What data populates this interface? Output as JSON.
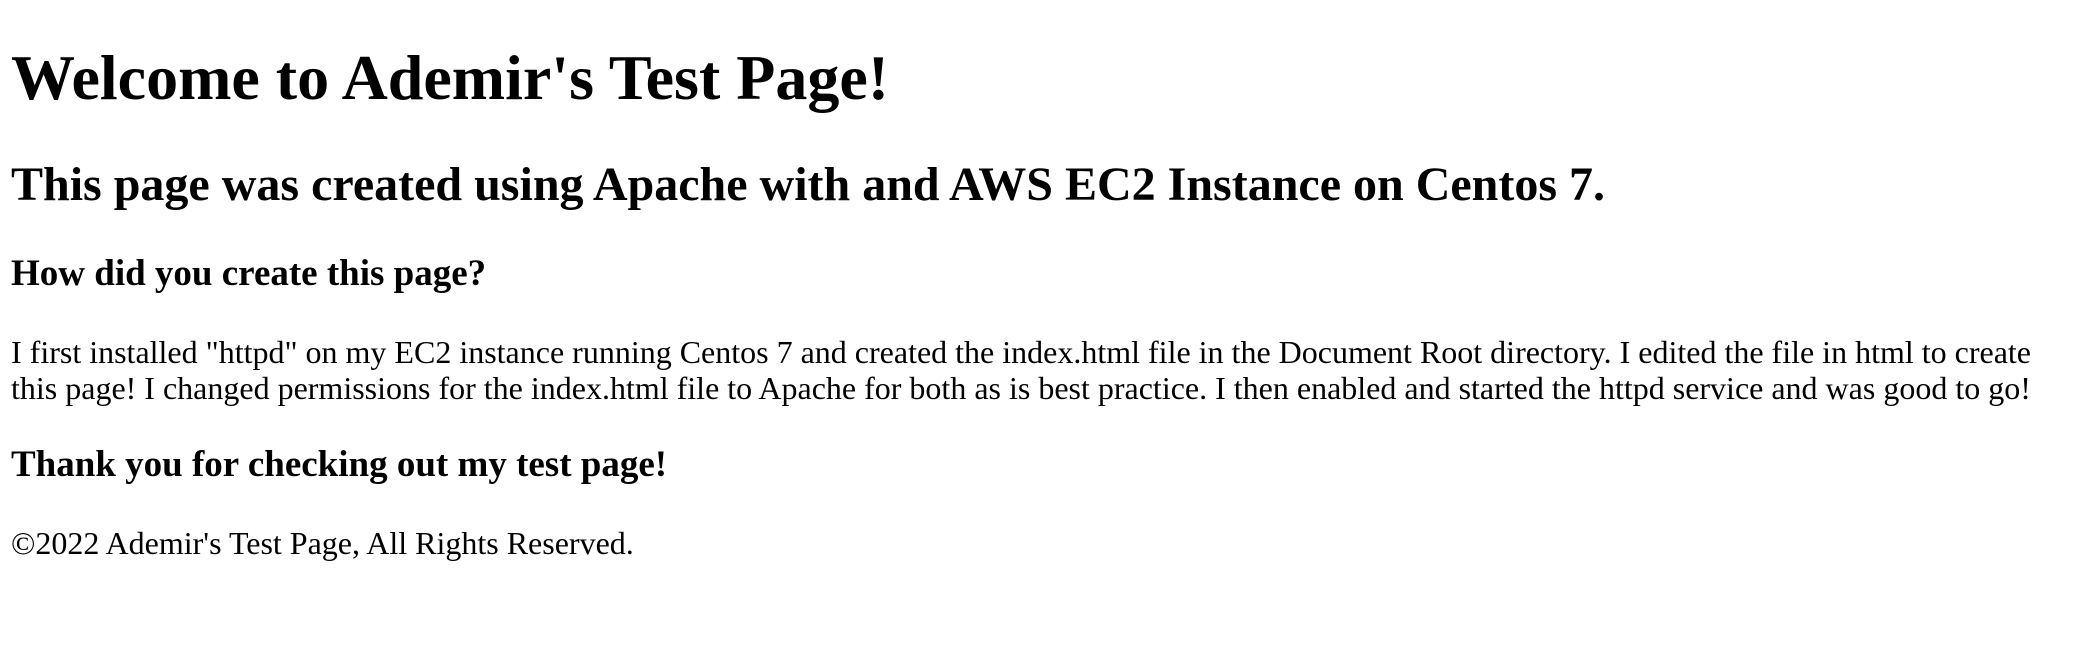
{
  "page": {
    "heading": "Welcome to Ademir's Test Page!",
    "subheading": "This page was created using Apache with and AWS EC2 Instance on Centos 7.",
    "question": "How did you create this page?",
    "paragraph": "I first installed \"httpd\" on my EC2 instance running Centos 7 and created the index.html file in the Document Root directory. I edited the file in html to create this page! I changed permissions for the index.html file to Apache for both as is best practice. I then enabled and started the httpd service and was good to go!",
    "thanks": "Thank you for checking out my test page!",
    "footer": "©2022 Ademir's Test Page, All Rights Reserved."
  }
}
